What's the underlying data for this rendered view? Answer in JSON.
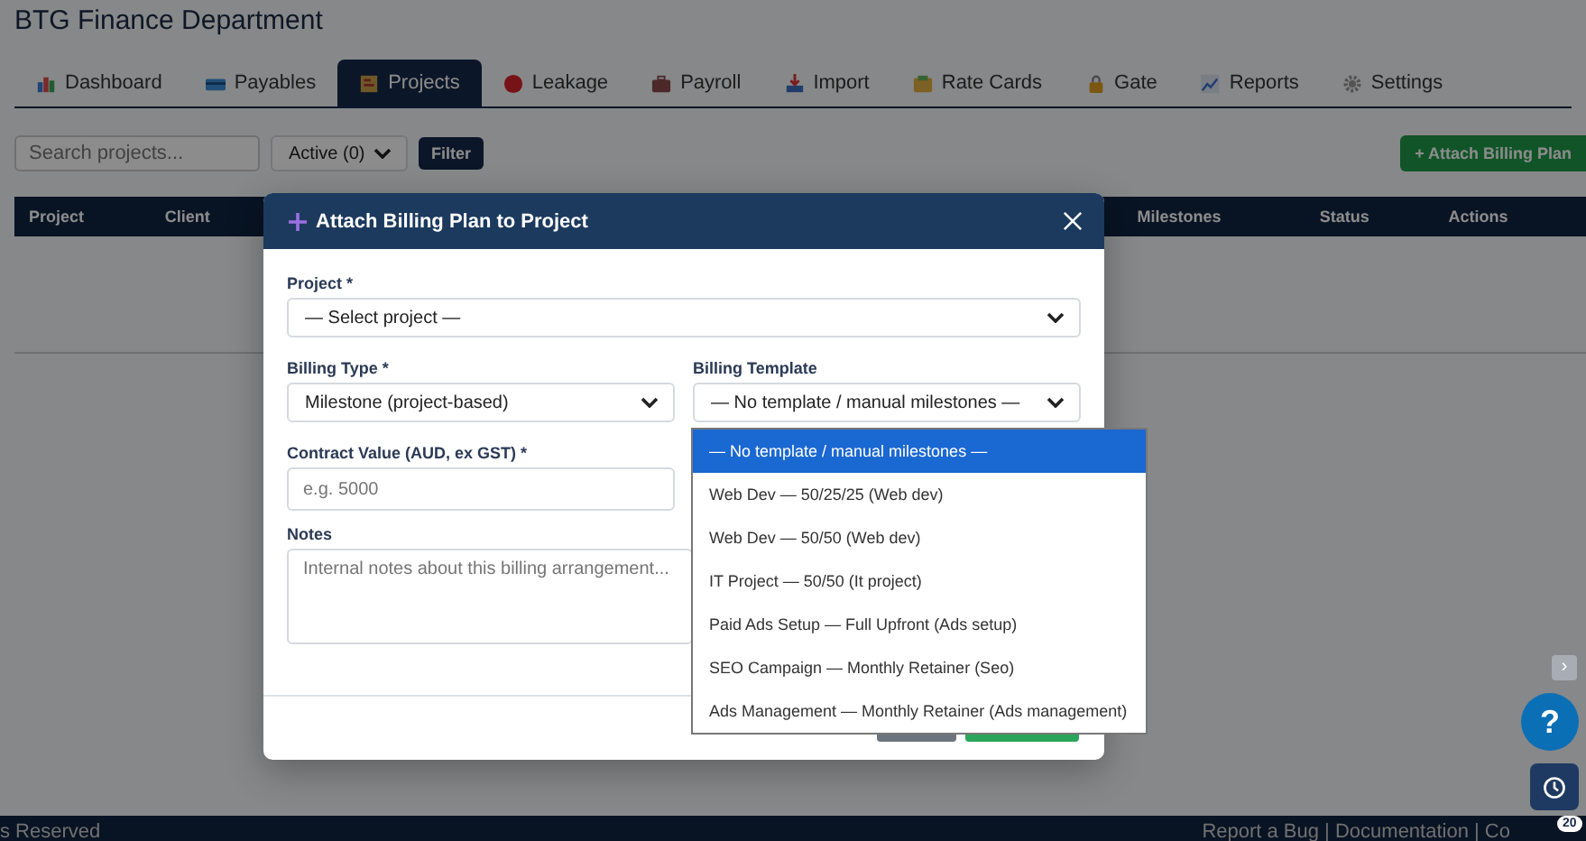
{
  "app_title": "BTG Finance Department",
  "tabs": [
    {
      "label": "Dashboard",
      "selected": false
    },
    {
      "label": "Payables",
      "selected": false
    },
    {
      "label": "Projects",
      "selected": true
    },
    {
      "label": "Leakage",
      "selected": false
    },
    {
      "label": "Payroll",
      "selected": false
    },
    {
      "label": "Import",
      "selected": false
    },
    {
      "label": "Rate Cards",
      "selected": false
    },
    {
      "label": "Gate",
      "selected": false
    },
    {
      "label": "Reports",
      "selected": false
    },
    {
      "label": "Settings",
      "selected": false
    }
  ],
  "toolbar": {
    "search": {
      "placeholder": "Search projects..."
    },
    "status_filter": {
      "value": "Active (0)"
    },
    "filter_button": "Filter",
    "attach_button": "+ Attach Billing Plan"
  },
  "table": {
    "columns": [
      "Project",
      "Client",
      "Milestones",
      "Status",
      "Actions"
    ]
  },
  "modal": {
    "title": "Attach Billing Plan to Project",
    "project": {
      "label": "Project *",
      "value": "— Select project —"
    },
    "billing_type": {
      "label": "Billing Type *",
      "value": "Milestone (project-based)"
    },
    "billing_template": {
      "label": "Billing Template",
      "value": "— No template / manual milestones —"
    },
    "contract_value": {
      "label": "Contract Value (AUD, ex GST) *",
      "placeholder": "e.g. 5000"
    },
    "notes": {
      "label": "Notes",
      "placeholder": "Internal notes about this billing arrangement..."
    }
  },
  "template_options": [
    {
      "label": "— No template / manual milestones —",
      "selected": true
    },
    {
      "label": "Web Dev — 50/25/25 (Web dev)",
      "selected": false
    },
    {
      "label": "Web Dev — 50/50 (Web dev)",
      "selected": false
    },
    {
      "label": "IT Project — 50/50 (It project)",
      "selected": false
    },
    {
      "label": "Paid Ads Setup — Full Upfront (Ads setup)",
      "selected": false
    },
    {
      "label": "SEO Campaign — Monthly Retainer (Seo)",
      "selected": false
    },
    {
      "label": "Ads Management — Monthly Retainer (Ads management)",
      "selected": false
    }
  ],
  "collapse_button": "›",
  "help_button": "?",
  "notification_count": "20",
  "footer": {
    "left": "s Reserved",
    "right": "Report a Bug | Documentation | Co"
  }
}
